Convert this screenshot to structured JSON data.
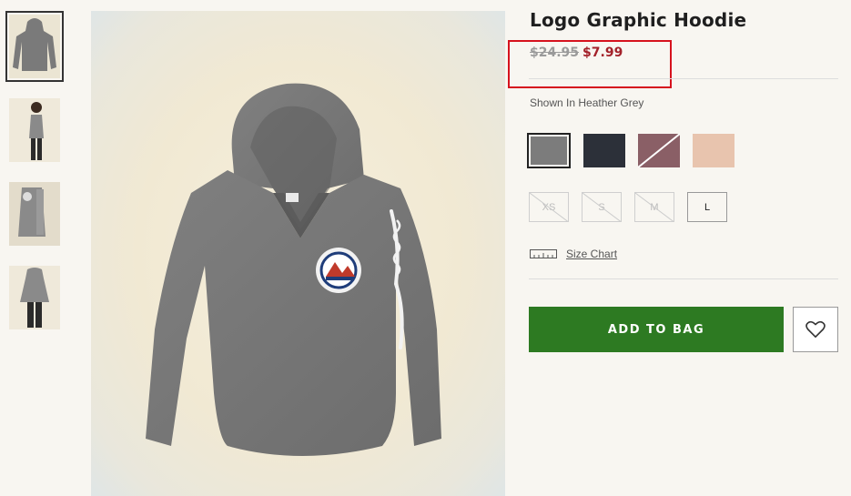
{
  "product": {
    "title": "Logo Graphic Hoodie",
    "original_price": "$24.95",
    "sale_price": "$7.99",
    "shown_in": "Shown In Heather Grey"
  },
  "thumbnails": [
    {
      "name": "hoodie-flat",
      "active": true
    },
    {
      "name": "model-side",
      "active": false
    },
    {
      "name": "model-sleeve",
      "active": false
    },
    {
      "name": "model-back",
      "active": false
    }
  ],
  "swatches": [
    {
      "name": "heather-grey",
      "color": "#7c7c7c",
      "selected": true,
      "available": true
    },
    {
      "name": "navy",
      "color": "#2c3039",
      "selected": false,
      "available": true
    },
    {
      "name": "burgundy-heather",
      "color": "#8a5f66",
      "selected": false,
      "available": false
    },
    {
      "name": "peach",
      "color": "#e8c4ae",
      "selected": false,
      "available": true
    }
  ],
  "sizes": [
    {
      "label": "XS",
      "available": false
    },
    {
      "label": "S",
      "available": false
    },
    {
      "label": "M",
      "available": false
    },
    {
      "label": "L",
      "available": true
    }
  ],
  "size_chart": {
    "label": "Size Chart",
    "icon": "ruler-icon"
  },
  "actions": {
    "add_to_bag": "ADD TO BAG",
    "wishlist_icon": "heart-icon"
  },
  "colors": {
    "accent_green": "#2d7a22",
    "sale_red": "#a3212a",
    "highlight_red": "#d6121e"
  }
}
